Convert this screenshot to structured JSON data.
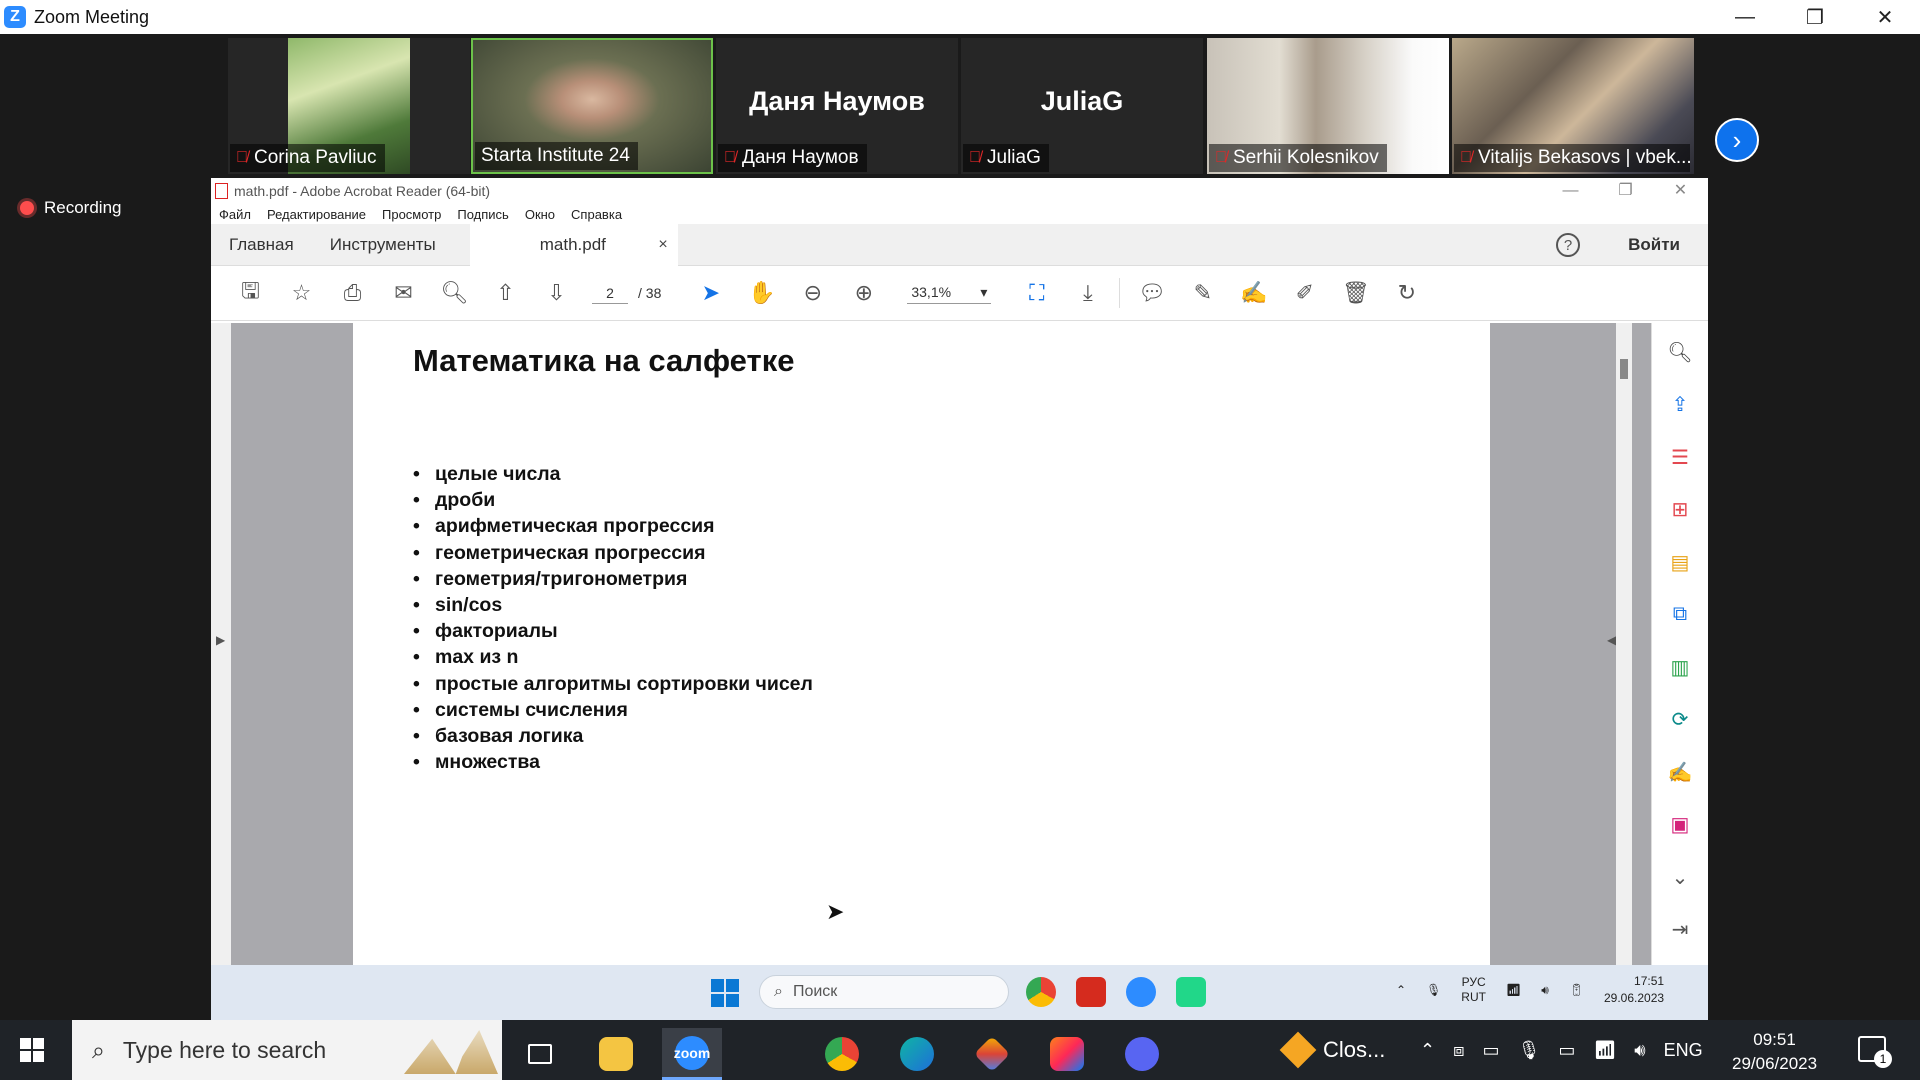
{
  "window": {
    "app_title": "Zoom Meeting",
    "controls": [
      "—",
      "❐",
      "✕"
    ]
  },
  "participants": [
    {
      "name": "Corina Pavliuc",
      "muted": true,
      "video": true,
      "big_name": ""
    },
    {
      "name": "Starta Institute 24",
      "muted": false,
      "video": true,
      "big_name": ""
    },
    {
      "name": "Даня Наумов",
      "muted": true,
      "video": false,
      "big_name": "Даня Наумов"
    },
    {
      "name": "JuliaG",
      "muted": true,
      "video": false,
      "big_name": "JuliaG"
    },
    {
      "name": "Serhii Kolesnikov",
      "muted": true,
      "video": true,
      "big_name": ""
    },
    {
      "name": "Vitalijs Bekasovs | vbek...",
      "muted": true,
      "video": true,
      "big_name": ""
    }
  ],
  "next_page_icon": "chevron-right-icon",
  "recording_label": "Recording",
  "acrobat": {
    "title": "math.pdf - Adobe Acrobat Reader (64-bit)",
    "menu": [
      "Файл",
      "Редактирование",
      "Просмотр",
      "Подпись",
      "Окно",
      "Справка"
    ],
    "tabs": {
      "home": "Главная",
      "tools": "Инструменты",
      "doc": "math.pdf",
      "close": "×"
    },
    "help": "?",
    "signin": "Войти",
    "page_current": "2",
    "page_total": "/ 38",
    "zoom": "33,1%"
  },
  "document": {
    "title": "Математика на салфетке",
    "bullets": [
      "целые числа",
      "дроби",
      "арифметическая прогрессия",
      "геометрическая прогрессия",
      "геометрия/тригонометрия",
      "sin/cos",
      "факториалы",
      "max из n",
      "простые алгоритмы сортировки чисел",
      "системы счисления",
      "базовая логика",
      "множества"
    ]
  },
  "inner_taskbar": {
    "search_placeholder": "Поиск",
    "lang_top": "РУС",
    "lang_bottom": "RUT",
    "time": "17:51",
    "date": "29.06.2023"
  },
  "taskbar": {
    "search_placeholder": "Type here to search",
    "zoom_label": "zoom",
    "closing_item": "Clos...",
    "lang": "ENG",
    "time": "09:51",
    "date": "29/06/2023",
    "notifications": "1"
  },
  "colors": {
    "zoom_blue": "#2d8cff",
    "active_speaker": "#6cc24a",
    "acrobat_blue": "#1473e6",
    "recording_red": "#ff4d4d"
  }
}
